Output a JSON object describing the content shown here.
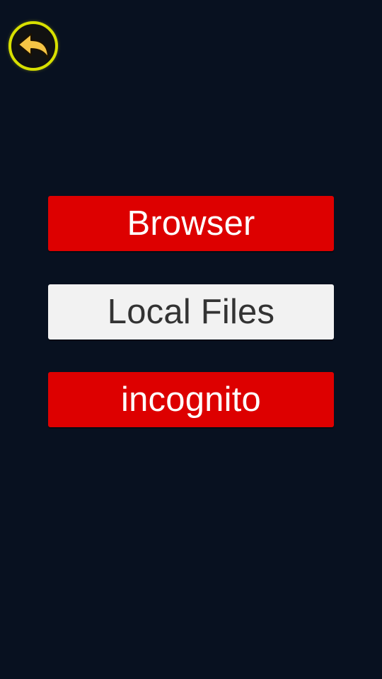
{
  "colors": {
    "background": "#081120",
    "primary_button": "#dd0000",
    "secondary_button": "#f2f2f2",
    "primary_text": "#ffffff",
    "secondary_text": "#333333",
    "back_icon_fill": "#f5c445",
    "back_icon_ring": "#e3e800"
  },
  "header": {
    "back_icon": "back-arrow-icon"
  },
  "menu": {
    "browser_label": "Browser",
    "local_files_label": "Local Files",
    "incognito_label": "incognito"
  }
}
